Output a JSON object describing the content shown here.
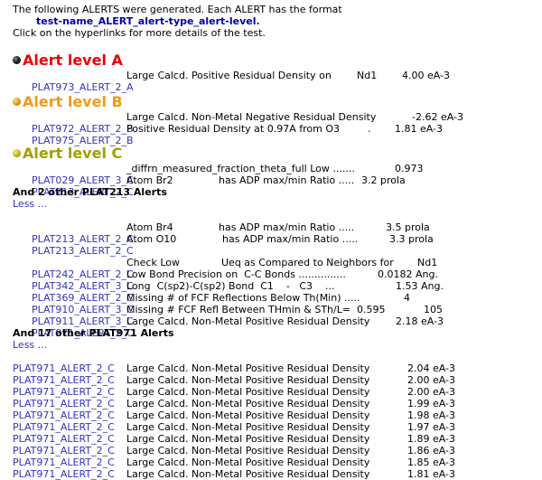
{
  "intro": {
    "line1": "The following ALERTS were generated. Each ALERT has the format",
    "format": "test-name_ALERT_alert-type_alert-level.",
    "line3": "Click on the hyperlinks for more details of the test."
  },
  "colors": {
    "level_a": "#ee0000",
    "level_b": "#f39a12",
    "level_c": "#a0a000",
    "link": "#3333bb",
    "format": "#0000aa"
  },
  "level_a": {
    "title": "Alert level A",
    "alerts": [
      {
        "code": "PLAT973_ALERT_2_A",
        "desc": "Large Calcd. Positive Residual Density on",
        "extra": "Nd1",
        "value": "4.00 eA-3"
      }
    ]
  },
  "level_b": {
    "title": "Alert level B",
    "alerts": [
      {
        "code": "PLAT972_ALERT_2_B",
        "desc": "Large Calcd. Non-Metal Negative Residual Density",
        "value": "-2.62 eA-3"
      },
      {
        "code": "PLAT975_ALERT_2_B",
        "desc": "Positive Residual Density at 0.97A from O3",
        "extra": ".",
        "value": "1.81 eA-3"
      }
    ]
  },
  "level_c": {
    "title": "Alert level C",
    "group1": [
      {
        "code": "PLAT029_ALERT_3_C",
        "desc": "_diffrn_measured_fraction_theta_full Low .......",
        "value": "0.973"
      },
      {
        "code": "PLAT213_ALERT_2_C",
        "desc": "Atom Br2",
        "extra": "has ADP max/min Ratio .....",
        "value": "3.2 prola"
      }
    ],
    "more213": "And 2 other PLAT213 Alerts",
    "less1": "Less ...",
    "group2": [
      {
        "code": "PLAT213_ALERT_2_C",
        "desc": "Atom Br4",
        "extra": "has ADP max/min Ratio .....",
        "value": "3.5 prola"
      },
      {
        "code": "PLAT213_ALERT_2_C",
        "desc": "Atom O10",
        "extra": "has ADP max/min Ratio .....",
        "value": "3.3 prola"
      }
    ],
    "group3": [
      {
        "code": "PLAT242_ALERT_2_C",
        "desc": "Check Low",
        "extra": "Ueq as Compared to Neighbors for",
        "value": "Nd1"
      },
      {
        "code": "PLAT342_ALERT_3_C",
        "desc": "Low Bond Precision on  C-C Bonds ...............",
        "value": "0.0182 Ang."
      },
      {
        "code": "PLAT369_ALERT_2_C",
        "desc": "Long  C(sp2)-C(sp2) Bond  C1    -   C3    ...",
        "value": "1.53 Ang."
      },
      {
        "code": "PLAT910_ALERT_3_C",
        "desc": "Missing # of FCF Reflections Below Th(Min) .....",
        "value": "4"
      },
      {
        "code": "PLAT911_ALERT_3_C",
        "desc": "Missing # FCF Refl Between THmin & STh/L=  0.595",
        "value": "105"
      },
      {
        "code": "PLAT971_ALERT_2_C",
        "desc": "Large Calcd. Non-Metal Positive Residual Density",
        "value": "2.18 eA-3"
      }
    ],
    "more971": "And 17 other PLAT971 Alerts",
    "less2": "Less ...",
    "group4": [
      {
        "code": "PLAT971_ALERT_2_C",
        "desc": "Large Calcd. Non-Metal Positive Residual Density",
        "value": "2.04 eA-3"
      },
      {
        "code": "PLAT971_ALERT_2_C",
        "desc": "Large Calcd. Non-Metal Positive Residual Density",
        "value": "2.00 eA-3"
      },
      {
        "code": "PLAT971_ALERT_2_C",
        "desc": "Large Calcd. Non-Metal Positive Residual Density",
        "value": "2.00 eA-3"
      },
      {
        "code": "PLAT971_ALERT_2_C",
        "desc": "Large Calcd. Non-Metal Positive Residual Density",
        "value": "1.99 eA-3"
      },
      {
        "code": "PLAT971_ALERT_2_C",
        "desc": "Large Calcd. Non-Metal Positive Residual Density",
        "value": "1.98 eA-3"
      },
      {
        "code": "PLAT971_ALERT_2_C",
        "desc": "Large Calcd. Non-Metal Positive Residual Density",
        "value": "1.97 eA-3"
      },
      {
        "code": "PLAT971_ALERT_2_C",
        "desc": "Large Calcd. Non-Metal Positive Residual Density",
        "value": "1.89 eA-3"
      },
      {
        "code": "PLAT971_ALERT_2_C",
        "desc": "Large Calcd. Non-Metal Positive Residual Density",
        "value": "1.86 eA-3"
      },
      {
        "code": "PLAT971_ALERT_2_C",
        "desc": "Large Calcd. Non-Metal Positive Residual Density",
        "value": "1.85 eA-3"
      },
      {
        "code": "PLAT971_ALERT_2_C",
        "desc": "Large Calcd. Non-Metal Positive Residual Density",
        "value": "1.81 eA-3"
      }
    ]
  }
}
